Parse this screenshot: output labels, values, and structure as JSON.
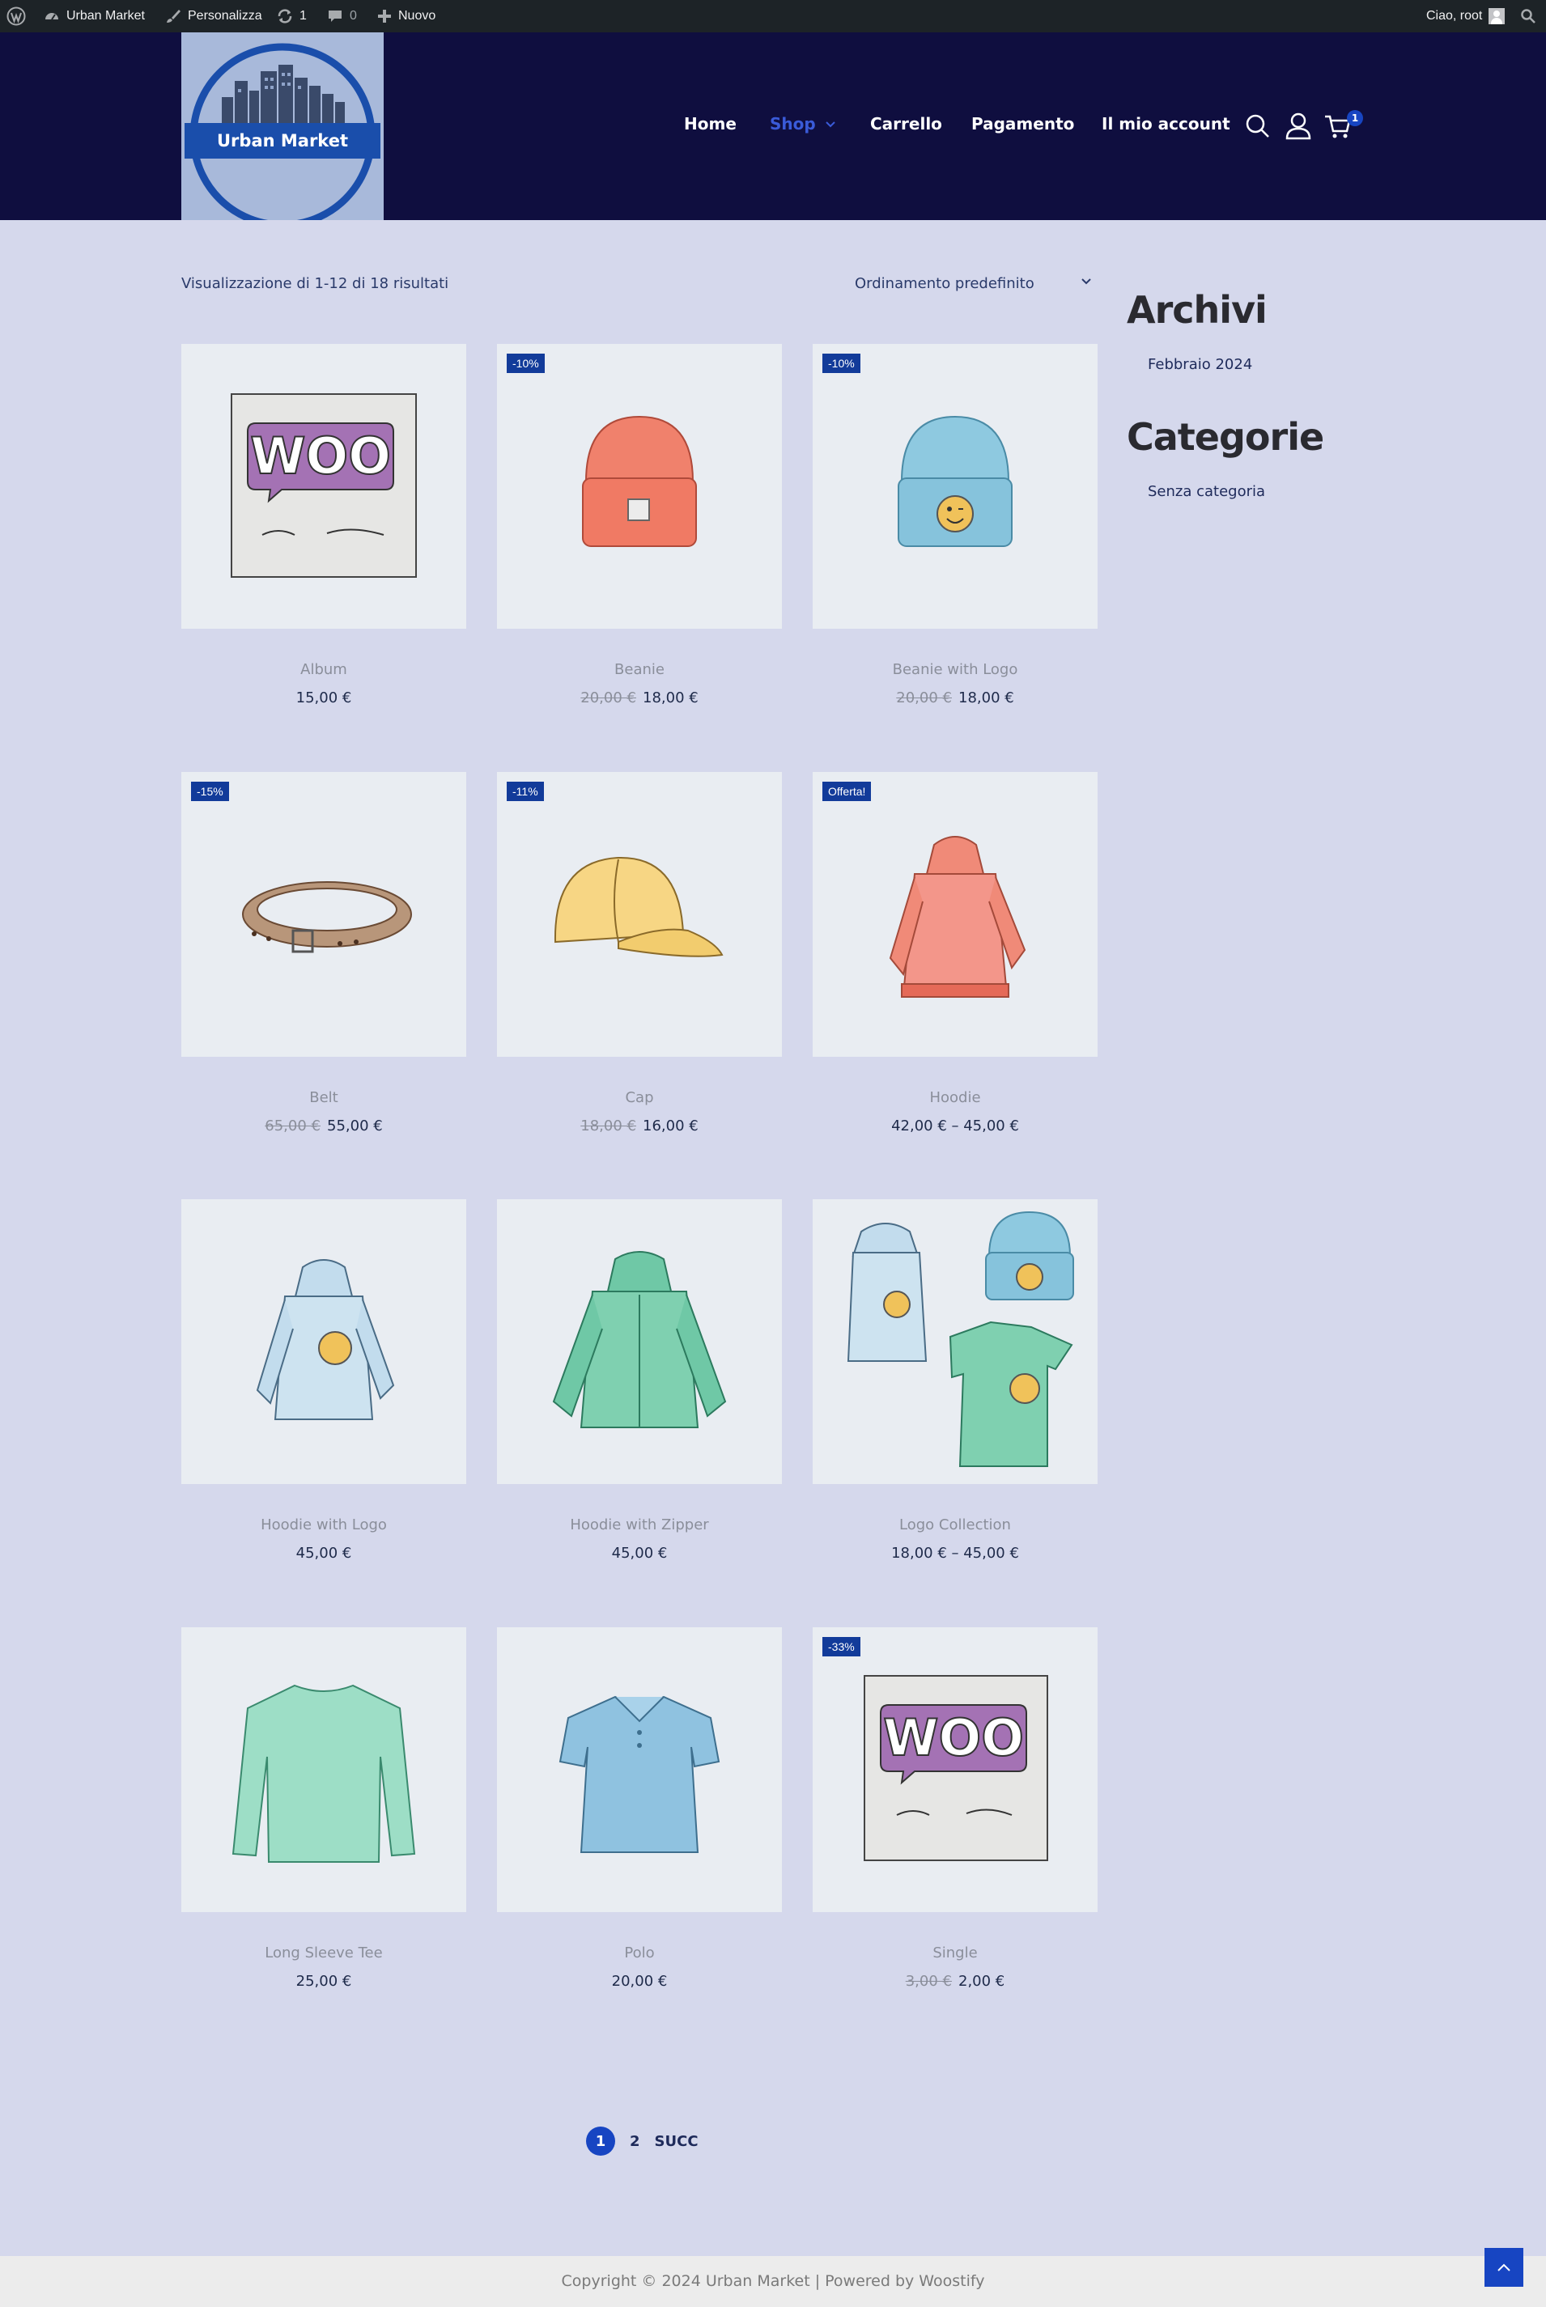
{
  "adminbar": {
    "site_name": "Urban Market",
    "customize": "Personalizza",
    "updates_count": "1",
    "comments_count": "0",
    "new_label": "Nuovo",
    "greeting": "Ciao, root"
  },
  "logo": {
    "text": "Urban Market"
  },
  "nav": {
    "items": [
      "Home",
      "Shop",
      "Carrello",
      "Pagamento",
      "Il mio account"
    ],
    "cart_count": "1"
  },
  "shop": {
    "results_text": "Visualizzazione di 1-12 di 18 risultati",
    "sort_label": "Ordinamento predefinito"
  },
  "products": [
    {
      "name": "Album",
      "price": "15,00 €",
      "old_price": "",
      "badge": "",
      "image": "album"
    },
    {
      "name": "Beanie",
      "price": "18,00 €",
      "old_price": "20,00 €",
      "badge": "-10%",
      "image": "beanie-orange"
    },
    {
      "name": "Beanie with Logo",
      "price": "18,00 €",
      "old_price": "20,00 €",
      "badge": "-10%",
      "image": "beanie-blue"
    },
    {
      "name": "Belt",
      "price": "55,00 €",
      "old_price": "65,00 €",
      "badge": "-15%",
      "image": "belt"
    },
    {
      "name": "Cap",
      "price": "16,00 €",
      "old_price": "18,00 €",
      "badge": "-11%",
      "image": "cap"
    },
    {
      "name": "Hoodie",
      "price": "42,00 € – 45,00 €",
      "old_price": "",
      "badge": "Offerta!",
      "image": "hoodie-red"
    },
    {
      "name": "Hoodie with Logo",
      "price": "45,00 €",
      "old_price": "",
      "badge": "",
      "image": "hoodie-blue"
    },
    {
      "name": "Hoodie with Zipper",
      "price": "45,00 €",
      "old_price": "",
      "badge": "",
      "image": "hoodie-zip"
    },
    {
      "name": "Logo Collection",
      "price": "18,00 € – 45,00 €",
      "old_price": "",
      "badge": "",
      "image": "collection"
    },
    {
      "name": "Long Sleeve Tee",
      "price": "25,00 €",
      "old_price": "",
      "badge": "",
      "image": "longsleeve"
    },
    {
      "name": "Polo",
      "price": "20,00 €",
      "old_price": "",
      "badge": "",
      "image": "polo"
    },
    {
      "name": "Single",
      "price": "2,00 €",
      "old_price": "3,00 €",
      "badge": "-33%",
      "image": "single"
    }
  ],
  "sidebar": {
    "archive_title": "Archivi",
    "archive_link": "Febbraio 2024",
    "categories_title": "Categorie",
    "category_link": "Senza categoria"
  },
  "pagination": {
    "current": "1",
    "next_page": "2",
    "next_label": "SUCC"
  },
  "footer": {
    "text": "Copyright © 2024 Urban Market | Powered by Woostify"
  },
  "colors": {
    "header_bg": "#0f0e3f",
    "page_bg": "#d5d8ec",
    "accent": "#1745c2",
    "badge": "#123b9a"
  }
}
